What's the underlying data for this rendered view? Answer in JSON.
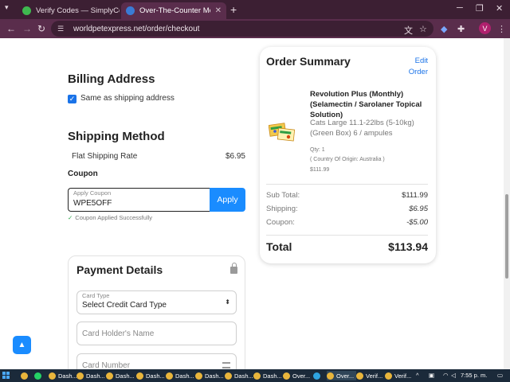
{
  "browser": {
    "tabs": [
      {
        "title": "Verify Codes — SimplyCodes",
        "active": false
      },
      {
        "title": "Over-The-Counter Medication",
        "active": true
      }
    ],
    "url": "worldpetexpress.net/order/checkout",
    "profile_initial": "V"
  },
  "billing": {
    "title": "Billing Address",
    "same_as_shipping_label": "Same as shipping address",
    "same_as_shipping_checked": true
  },
  "shipping": {
    "title": "Shipping Method",
    "method_label": "Flat Shipping Rate",
    "method_price": "$6.95"
  },
  "coupon": {
    "title": "Coupon",
    "field_label": "Apply Coupon",
    "field_value": "WPE5OFF",
    "apply_label": "Apply",
    "success_message": "Coupon Applied Successfully"
  },
  "payment": {
    "title": "Payment Details",
    "card_type_label": "Card Type",
    "card_type_value": "Select Credit Card Type",
    "holder_placeholder": "Card Holder's Name",
    "number_placeholder": "Card Number"
  },
  "summary": {
    "title": "Order Summary",
    "edit_line1": "Edit",
    "edit_line2": "Order",
    "product": {
      "name": "Revolution Plus (Monthly) (Selamectin / Sarolaner Topical Solution)",
      "variant": "Cats Large 11.1-22lbs (5-10kg) (Green Box) 6 / ampules",
      "qty": "Qty: 1",
      "origin": "( Country Of Origin: Australia )",
      "price": "$111.99"
    },
    "subtotal_label": "Sub Total:",
    "subtotal_value": "$111.99",
    "shipping_label": "Shipping:",
    "shipping_value": "$6.95",
    "coupon_label": "Coupon:",
    "coupon_value": "-$5.00",
    "total_label": "Total",
    "total_value": "$113.94"
  },
  "taskbar": {
    "items": [
      "Dash...",
      "Dash...",
      "Dash...",
      "Dash...",
      "Dash...",
      "Dash...",
      "Dash...",
      "Dash...",
      "Over...",
      "Verif...",
      "Verif..."
    ],
    "time": "7:55 p. m."
  }
}
